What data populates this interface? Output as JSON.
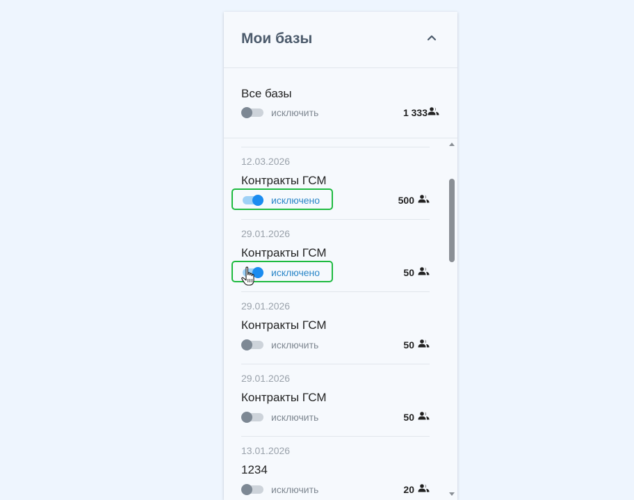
{
  "panel": {
    "title": "Мои базы",
    "collapse_icon": "chevron-up-icon"
  },
  "all_bases": {
    "title": "Все базы",
    "toggle_label": "исключить",
    "toggle_on": false,
    "count": "1 333",
    "count_icon": "people-icon"
  },
  "items": [
    {
      "date": "12.03.2026",
      "name": "Контракты ГСМ",
      "toggle_label": "исключено",
      "toggle_on": true,
      "count": "500",
      "highlighted": true
    },
    {
      "date": "29.01.2026",
      "name": "Контракты ГСМ",
      "toggle_label": "исключено",
      "toggle_on": true,
      "count": "50",
      "highlighted": true
    },
    {
      "date": "29.01.2026",
      "name": "Контракты ГСМ",
      "toggle_label": "исключить",
      "toggle_on": false,
      "count": "50",
      "highlighted": false
    },
    {
      "date": "29.01.2026",
      "name": "Контракты ГСМ",
      "toggle_label": "исключить",
      "toggle_on": false,
      "count": "50",
      "highlighted": false
    },
    {
      "date": "13.01.2026",
      "name": "1234",
      "toggle_label": "исключить",
      "toggle_on": false,
      "count": "20",
      "highlighted": false
    }
  ],
  "colors": {
    "accent": "#1b8cf0",
    "highlight": "#1dba3f",
    "background": "#eef5fe"
  }
}
